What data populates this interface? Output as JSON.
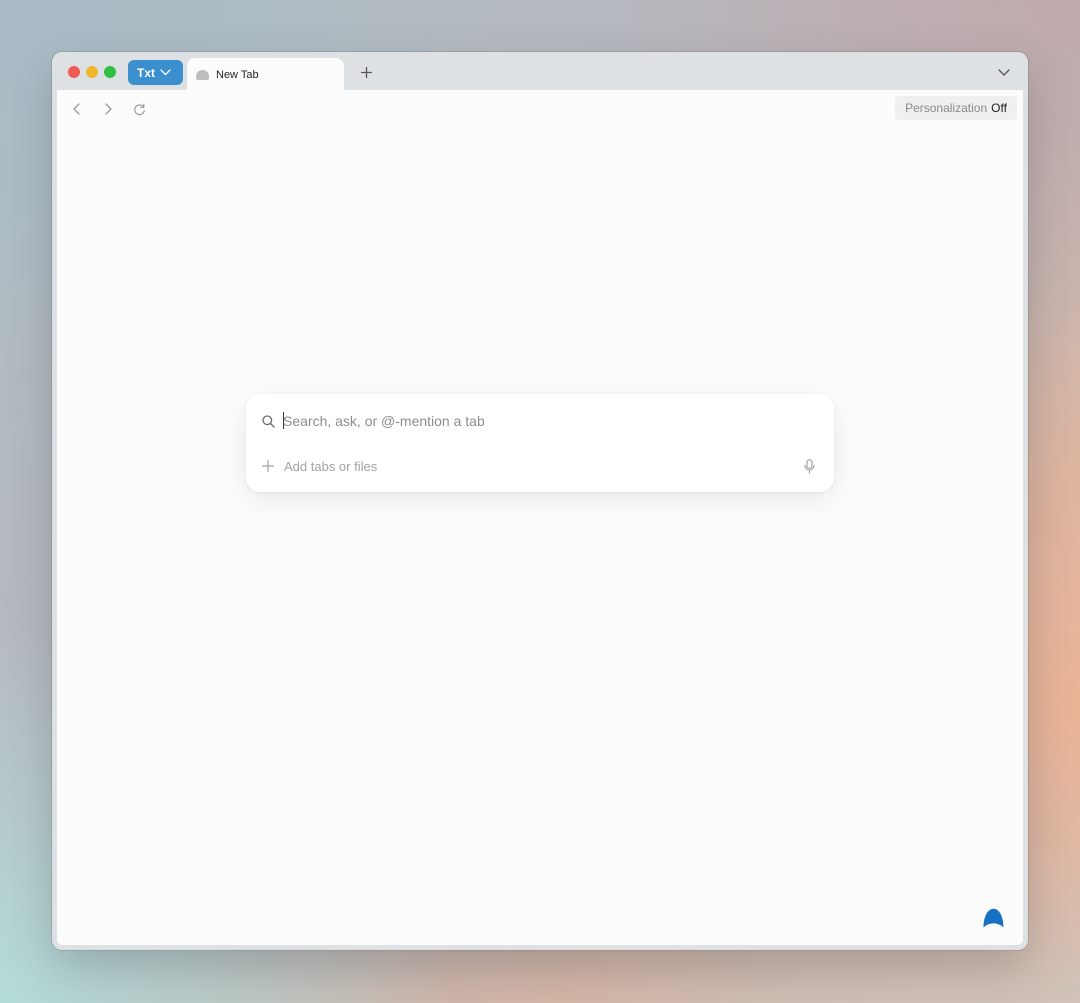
{
  "colors": {
    "accent": "#3b8fce",
    "assistant": "#1670c4",
    "traffic_close": "#f05b53",
    "traffic_minimize": "#f4b52e",
    "traffic_maximize": "#30c043"
  },
  "titlebar": {
    "space_label": "Txt",
    "space_icon": "chevron-down-icon",
    "tabs": [
      {
        "label": "New Tab",
        "icon": "favicon-icon",
        "active": true
      }
    ],
    "new_tab_icon": "plus-icon",
    "tab_overview_icon": "chevron-down-icon"
  },
  "toolbar": {
    "back_icon": "chevron-left-icon",
    "forward_icon": "chevron-right-icon",
    "reload_icon": "reload-icon",
    "personalization_label": "Personalization",
    "personalization_state": "Off"
  },
  "search": {
    "icon": "search-icon",
    "placeholder": "Search, ask, or @-mention a tab",
    "value": "",
    "add_label": "Add tabs or files",
    "add_icon": "plus-icon",
    "mic_icon": "microphone-icon"
  },
  "assistant": {
    "icon": "assistant-icon"
  }
}
